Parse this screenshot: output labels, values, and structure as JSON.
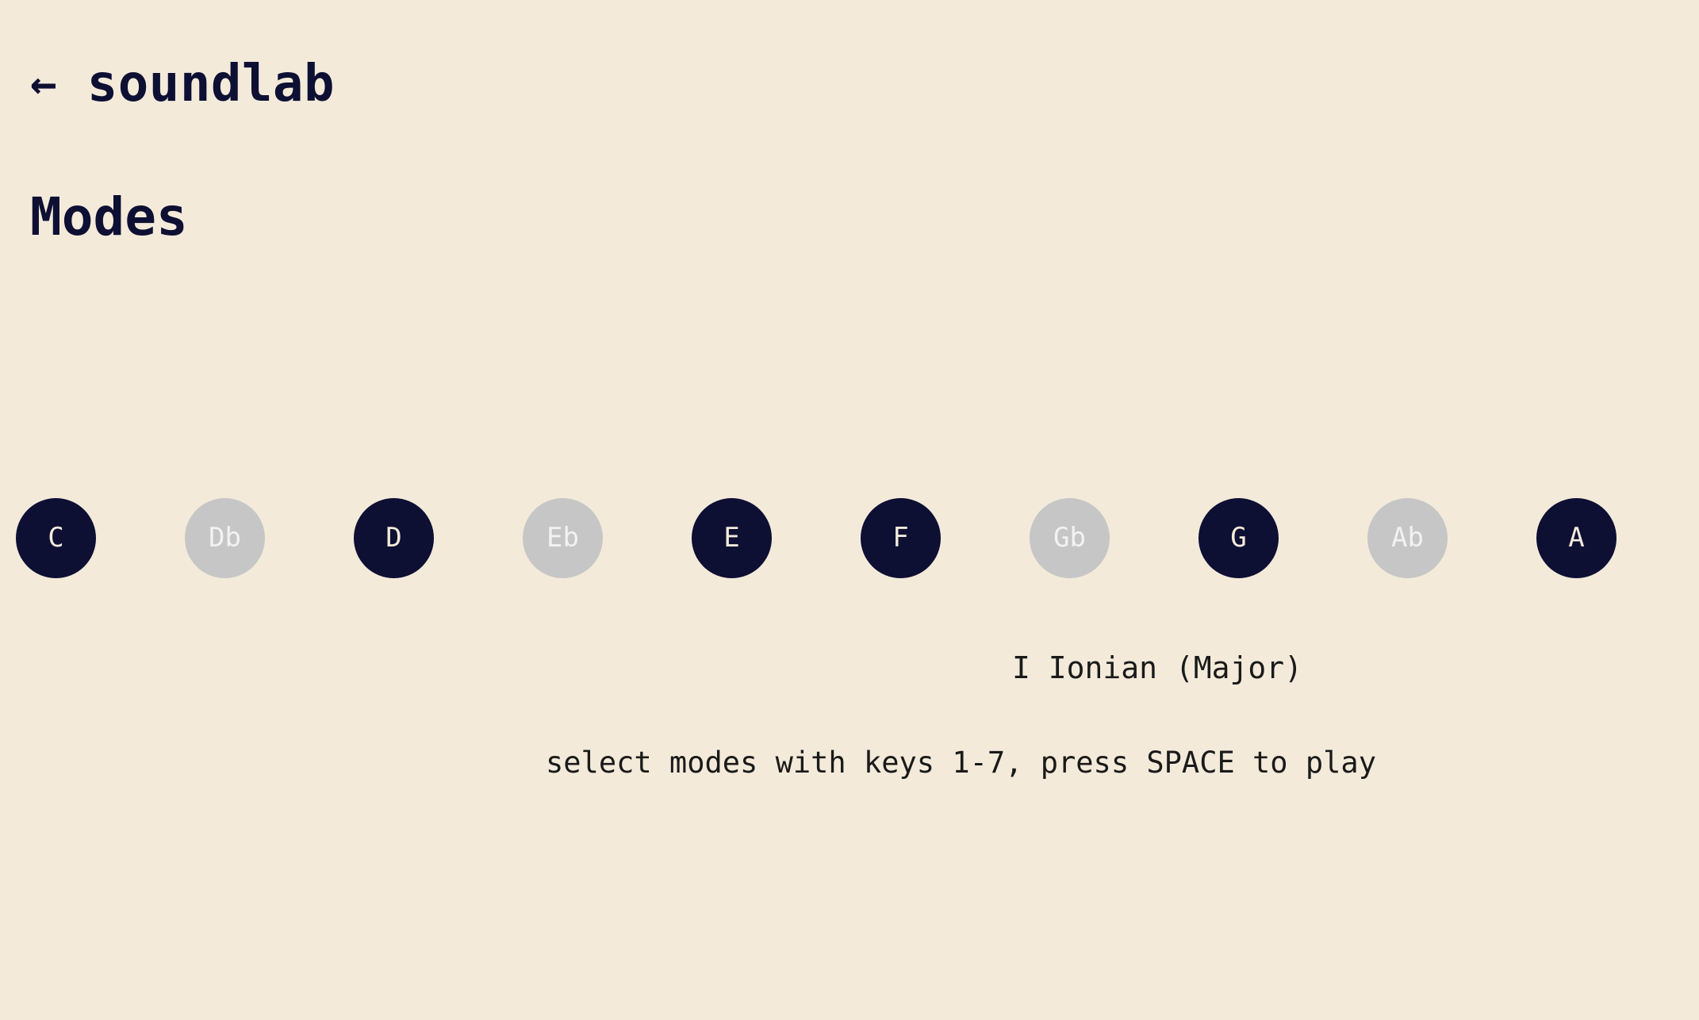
{
  "header": {
    "back_icon": "left-arrow-icon",
    "back_glyph": "←",
    "app_title": "soundlab"
  },
  "page": {
    "title": "Modes"
  },
  "notes": [
    {
      "label": "C",
      "active": true
    },
    {
      "label": "Db",
      "active": false
    },
    {
      "label": "D",
      "active": true
    },
    {
      "label": "Eb",
      "active": false
    },
    {
      "label": "E",
      "active": true
    },
    {
      "label": "F",
      "active": true
    },
    {
      "label": "Gb",
      "active": false
    },
    {
      "label": "G",
      "active": true
    },
    {
      "label": "Ab",
      "active": false
    },
    {
      "label": "A",
      "active": true
    }
  ],
  "mode": {
    "label": "I Ionian (Major)"
  },
  "instructions": "select modes with keys 1-7, press SPACE to play",
  "colors": {
    "background": "#f3eada",
    "active_note": "#0d0f33",
    "inactive_note": "#c6c6c6",
    "text": "#0d0f33"
  }
}
